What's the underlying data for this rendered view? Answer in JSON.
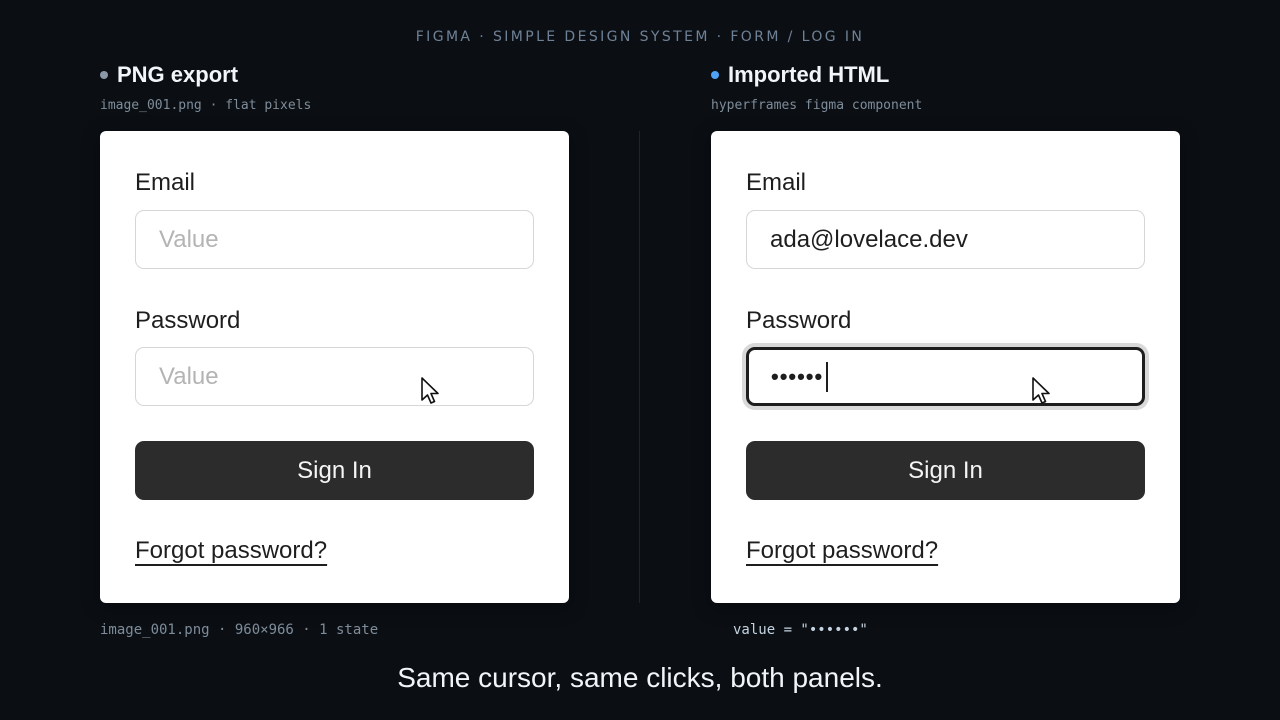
{
  "top_caption": "FIGMA · SIMPLE DESIGN SYSTEM · FORM / LOG IN",
  "left_panel": {
    "title": "PNG export",
    "subtitle": "image_001.png · flat pixels",
    "form": {
      "email_label": "Email",
      "email_placeholder": "Value",
      "password_label": "Password",
      "password_placeholder": "Value",
      "signin_label": "Sign In",
      "forgot_label": "Forgot password?"
    },
    "footer": "image_001.png · 960×966 · 1 state"
  },
  "right_panel": {
    "title": "Imported HTML",
    "subtitle": "hyperframes figma component",
    "form": {
      "email_label": "Email",
      "email_value": "ada@lovelace.dev",
      "password_label": "Password",
      "password_value": "••••••",
      "signin_label": "Sign In",
      "forgot_label": "Forgot password?"
    },
    "footer": "value = \"••••••\""
  },
  "bottom_subtitle": "Same cursor, same clicks, both panels.",
  "colors": {
    "background": "#0b0f14",
    "left_dot": "#8a98a8",
    "right_dot": "#4ea3f5",
    "button": "#2c2c2c"
  },
  "icons": {
    "cursor": "arrow-cursor-icon"
  }
}
